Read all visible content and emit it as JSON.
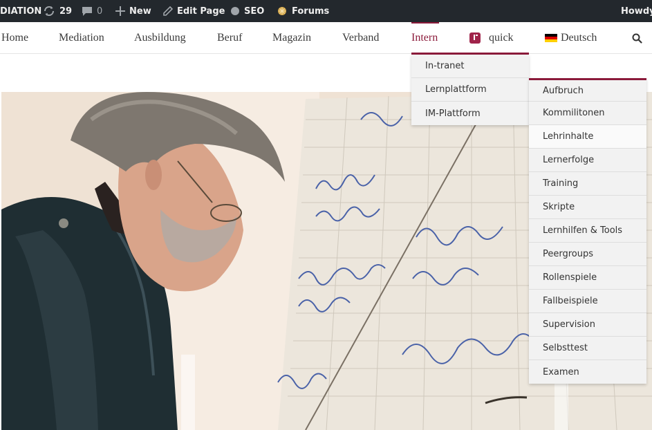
{
  "admin_bar": {
    "site_name": "DIATION",
    "updates_count": "29",
    "comments_count": "0",
    "new_label": "New",
    "edit_page_label": "Edit Page",
    "seo_label": "SEO",
    "forums_label": "Forums",
    "howdy_label": "Howdy,",
    "icons": [
      "refresh-icon",
      "comment-icon",
      "plus-icon",
      "pencil-icon",
      "dot-icon",
      "forums-icon"
    ]
  },
  "nav": {
    "items": [
      {
        "label": "Home"
      },
      {
        "label": "Mediation"
      },
      {
        "label": "Ausbildung"
      },
      {
        "label": "Beruf"
      },
      {
        "label": "Magazin"
      },
      {
        "label": "Verband"
      },
      {
        "label": "Intern",
        "active": true
      },
      {
        "label": "quick"
      },
      {
        "label": "Deutsch"
      }
    ],
    "accent_color": "#8b1a3a"
  },
  "intern_dropdown": {
    "items": [
      "In-tranet",
      "Lernplattform",
      "IM-Plattform"
    ]
  },
  "lernplattform_dropdown": {
    "items": [
      "Aufbruch",
      "Kommilitonen",
      "Lehrinhalte",
      "Lernerfolge",
      "Training",
      "Skripte",
      "Lernhilfen & Tools",
      "Peergroups",
      "Rollenspiele",
      "Fallbeispiele",
      "Supervision",
      "Selbsttest",
      "Examen"
    ],
    "hovered": "Lehrinhalte"
  },
  "colors": {
    "admin_bar_bg": "#23282d",
    "accent": "#8b1a3a",
    "dropdown_bg": "#f2f2f2"
  }
}
